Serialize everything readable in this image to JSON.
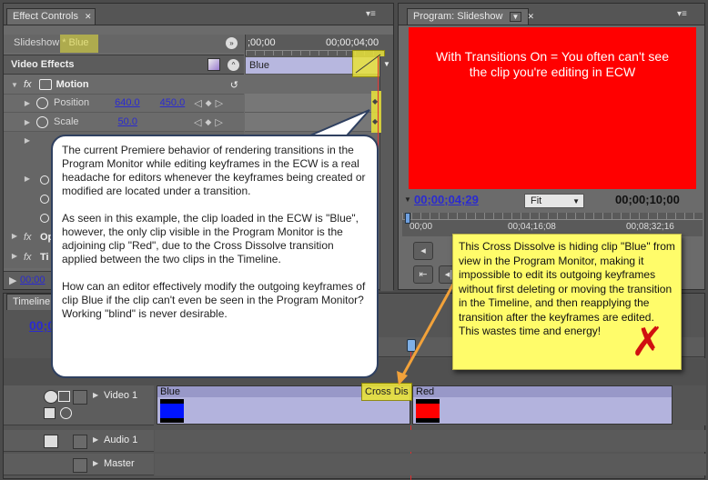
{
  "effect_controls": {
    "tab_label": "Effect Controls",
    "clip_label": "Slideshow * Blue",
    "time_start": ";00;00",
    "time_end": "00;00;04;00",
    "section_label": "Video Effects",
    "clip_bar_label": "Blue",
    "motion_label": "Motion",
    "position_label": "Position",
    "position_x": "640.0",
    "position_y": "450.0",
    "scale_label": "Scale",
    "scale_value": "50.0",
    "opacity_partial": "Op",
    "time_partial": "Ti",
    "bottom_time_partial": "00;00"
  },
  "program_monitor": {
    "tab_label": "Program: Slideshow",
    "overlay_text": "With Transitions On = You often can't see\nthe clip you're editing in ECW",
    "current_time": "00;00;04;29",
    "fit_label": "Fit",
    "duration": "00;00;10;00",
    "ruler_start": "00;00",
    "ruler_mid": "00;04;16;08",
    "ruler_end": "00;08;32;16",
    "colors": {
      "frame": "#ff0000"
    }
  },
  "timeline": {
    "tab_label": "Timeline",
    "time_partial": "00;0",
    "video_track_label": "Video 1",
    "audio_track_label": "Audio 1",
    "master_label": "Master",
    "clip_blue_label": "Blue",
    "clip_red_label": "Red",
    "transition_label": "Cross Dis"
  },
  "callout": {
    "text": "The current Premiere behavior of rendering transitions in the Program Monitor while editing keyframes in the ECW is a real headache for editors whenever the keyframes being created or modified are located under a transition.\n\nAs seen in this example, the clip loaded in the ECW is \"Blue\", however, the only clip visible in the Program Monitor is the adjoining clip \"Red\", due to the Cross Dissolve transition applied between the two clips in the Timeline.\n\nHow can an editor effectively modify the outgoing keyframes of clip Blue if the clip can't even be seen in the Program Monitor?  Working \"blind\" is never desirable."
  },
  "note": {
    "text": "This Cross Dissolve is hiding clip \"Blue\" from view in the Program Monitor, making it impossible to edit its outgoing keyframes without first deleting or moving the transition in the Timeline, and then reapplying the transition after the keyframes are edited.\nThis wastes time and energy!"
  },
  "icons": {
    "triangle_right": "▶",
    "triangle_down": "▼",
    "menu": "▾≡",
    "close": "✕",
    "keyframe": "◆",
    "prev": "◁",
    "next": "▷",
    "eye": "👁",
    "speaker": "🔈",
    "reset": "↺",
    "fx": "fx",
    "red_x": "✗"
  }
}
